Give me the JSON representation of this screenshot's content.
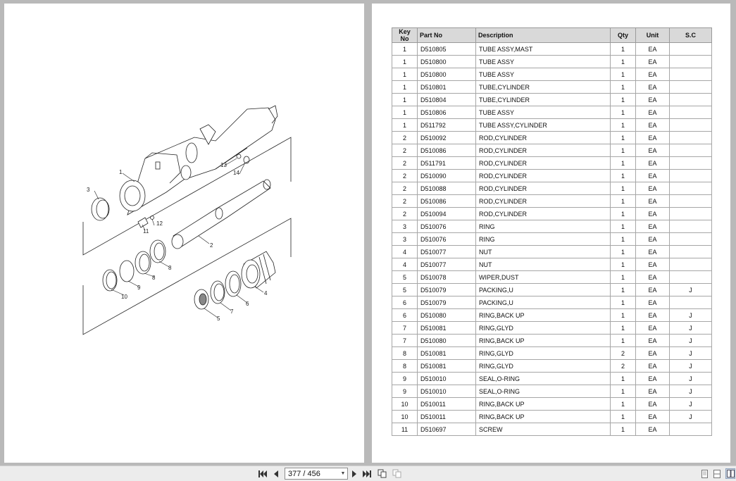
{
  "viewer": {
    "page_indicator": "377 / 456",
    "nav": {
      "first": "first-page-icon",
      "prev": "previous-page-icon",
      "next": "next-page-icon",
      "last": "last-page-icon",
      "copy": "copy-page-icon",
      "copy2": "copy-page-disabled-icon"
    },
    "view_modes": [
      "single-page-icon",
      "two-page-continuous-icon",
      "two-page-icon"
    ]
  },
  "diagram": {
    "callouts": [
      "1",
      "2",
      "3",
      "4",
      "5",
      "6",
      "7",
      "8",
      "8",
      "9",
      "10",
      "11",
      "12",
      "13",
      "14"
    ]
  },
  "table": {
    "headers": {
      "key": "Key No",
      "part": "Part No",
      "desc": "Description",
      "qty": "Qty",
      "unit": "Unit",
      "sc": "S.C"
    },
    "rows": [
      {
        "key": "1",
        "part": "D510805",
        "desc": "TUBE ASSY,MAST",
        "qty": "1",
        "unit": "EA",
        "sc": ""
      },
      {
        "key": "1",
        "part": "D510800",
        "desc": "TUBE ASSY",
        "qty": "1",
        "unit": "EA",
        "sc": ""
      },
      {
        "key": "1",
        "part": "D510800",
        "desc": "TUBE ASSY",
        "qty": "1",
        "unit": "EA",
        "sc": ""
      },
      {
        "key": "1",
        "part": "D510801",
        "desc": "TUBE,CYLINDER",
        "qty": "1",
        "unit": "EA",
        "sc": ""
      },
      {
        "key": "1",
        "part": "D510804",
        "desc": "TUBE,CYLINDER",
        "qty": "1",
        "unit": "EA",
        "sc": ""
      },
      {
        "key": "1",
        "part": "D510806",
        "desc": "TUBE ASSY",
        "qty": "1",
        "unit": "EA",
        "sc": ""
      },
      {
        "key": "1",
        "part": "D511792",
        "desc": "TUBE ASSY,CYLINDER",
        "qty": "1",
        "unit": "EA",
        "sc": ""
      },
      {
        "key": "2",
        "part": "D510092",
        "desc": "ROD,CYLINDER",
        "qty": "1",
        "unit": "EA",
        "sc": ""
      },
      {
        "key": "2",
        "part": "D510086",
        "desc": "ROD,CYLINDER",
        "qty": "1",
        "unit": "EA",
        "sc": ""
      },
      {
        "key": "2",
        "part": "D511791",
        "desc": "ROD,CYLINDER",
        "qty": "1",
        "unit": "EA",
        "sc": ""
      },
      {
        "key": "2",
        "part": "D510090",
        "desc": "ROD,CYLINDER",
        "qty": "1",
        "unit": "EA",
        "sc": ""
      },
      {
        "key": "2",
        "part": "D510088",
        "desc": "ROD,CYLINDER",
        "qty": "1",
        "unit": "EA",
        "sc": ""
      },
      {
        "key": "2",
        "part": "D510086",
        "desc": "ROD,CYLINDER",
        "qty": "1",
        "unit": "EA",
        "sc": ""
      },
      {
        "key": "2",
        "part": "D510094",
        "desc": "ROD,CYLINDER",
        "qty": "1",
        "unit": "EA",
        "sc": ""
      },
      {
        "key": "3",
        "part": "D510076",
        "desc": "RING",
        "qty": "1",
        "unit": "EA",
        "sc": ""
      },
      {
        "key": "3",
        "part": "D510076",
        "desc": "RING",
        "qty": "1",
        "unit": "EA",
        "sc": ""
      },
      {
        "key": "4",
        "part": "D510077",
        "desc": "NUT",
        "qty": "1",
        "unit": "EA",
        "sc": ""
      },
      {
        "key": "4",
        "part": "D510077",
        "desc": "NUT",
        "qty": "1",
        "unit": "EA",
        "sc": ""
      },
      {
        "key": "5",
        "part": "D510078",
        "desc": "WIPER,DUST",
        "qty": "1",
        "unit": "EA",
        "sc": ""
      },
      {
        "key": "5",
        "part": "D510079",
        "desc": "PACKING,U",
        "qty": "1",
        "unit": "EA",
        "sc": "J"
      },
      {
        "key": "6",
        "part": "D510079",
        "desc": "PACKING,U",
        "qty": "1",
        "unit": "EA",
        "sc": ""
      },
      {
        "key": "6",
        "part": "D510080",
        "desc": "RING,BACK UP",
        "qty": "1",
        "unit": "EA",
        "sc": "J"
      },
      {
        "key": "7",
        "part": "D510081",
        "desc": "RING,GLYD",
        "qty": "1",
        "unit": "EA",
        "sc": "J"
      },
      {
        "key": "7",
        "part": "D510080",
        "desc": "RING,BACK UP",
        "qty": "1",
        "unit": "EA",
        "sc": "J"
      },
      {
        "key": "8",
        "part": "D510081",
        "desc": "RING,GLYD",
        "qty": "2",
        "unit": "EA",
        "sc": "J"
      },
      {
        "key": "8",
        "part": "D510081",
        "desc": "RING,GLYD",
        "qty": "2",
        "unit": "EA",
        "sc": "J"
      },
      {
        "key": "9",
        "part": "D510010",
        "desc": "SEAL,O-RING",
        "qty": "1",
        "unit": "EA",
        "sc": "J"
      },
      {
        "key": "9",
        "part": "D510010",
        "desc": "SEAL,O-RING",
        "qty": "1",
        "unit": "EA",
        "sc": "J"
      },
      {
        "key": "10",
        "part": "D510011",
        "desc": "RING,BACK UP",
        "qty": "1",
        "unit": "EA",
        "sc": "J"
      },
      {
        "key": "10",
        "part": "D510011",
        "desc": "RING,BACK UP",
        "qty": "1",
        "unit": "EA",
        "sc": "J"
      },
      {
        "key": "11",
        "part": "D510697",
        "desc": "SCREW",
        "qty": "1",
        "unit": "EA",
        "sc": ""
      }
    ]
  }
}
